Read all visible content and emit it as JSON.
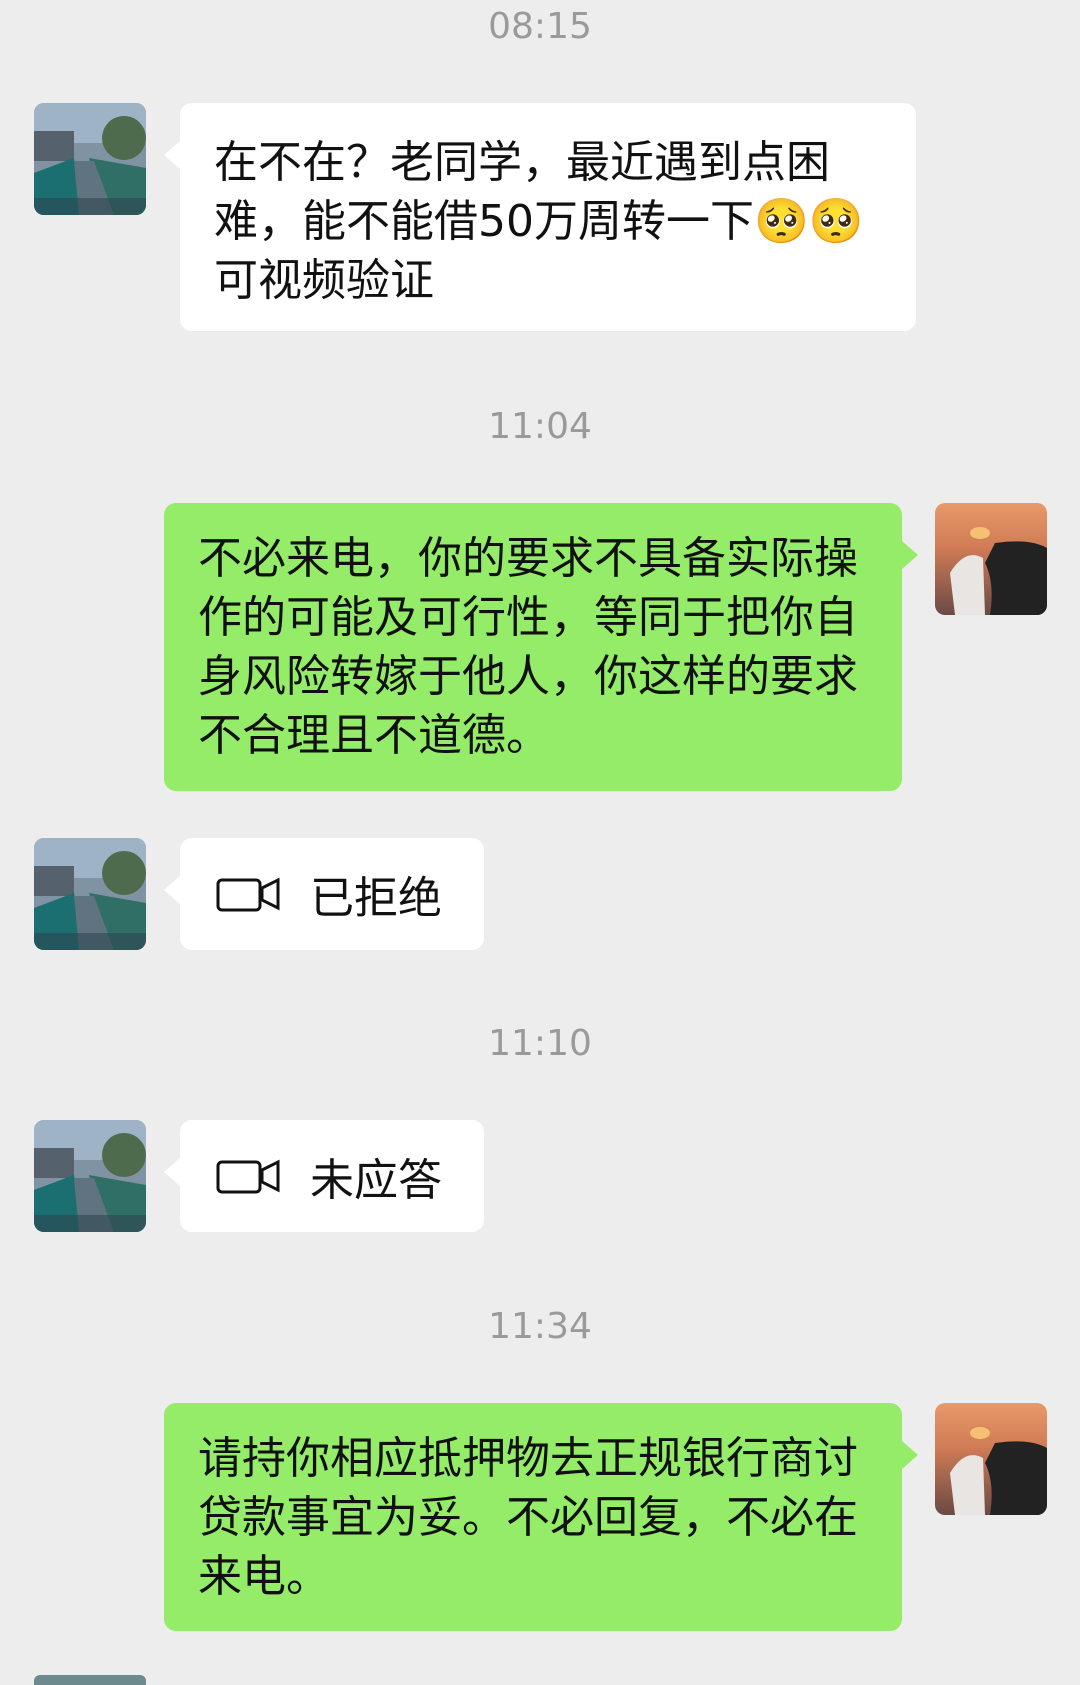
{
  "messages": {
    "ts1": "08:15",
    "msg1": "在不在？老同学，最近遇到点困难，能不能借50万周转一下🥺🥺可视频验证",
    "ts2": "11:04",
    "msg2": "不必来电，你的要求不具备实际操作的可能及可行性，等同于把你自身风险转嫁于他人，你这样的要求不合理且不道德。",
    "call1": "已拒绝",
    "ts3": "11:10",
    "call2": "未应答",
    "ts4": "11:34",
    "msg3": "请持你相应抵押物去正规银行商讨贷款事宜为妥。不必回复，不必在来电。"
  },
  "colors": {
    "background": "#ededed",
    "incoming_bubble": "#ffffff",
    "outgoing_bubble": "#95ec69",
    "timestamp": "#9a9a9a"
  },
  "icons": {
    "call": "video-camera-icon"
  }
}
